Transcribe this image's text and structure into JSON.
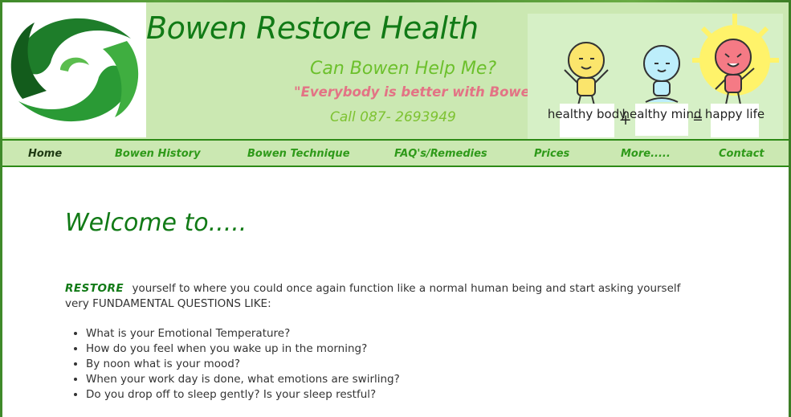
{
  "header": {
    "title": "Bowen Restore Health",
    "help_question": "Can Bowen Help Me?",
    "motto": "\"Everybody is better with Bowen\"",
    "phone": "Call 087- 2693949"
  },
  "illustration": {
    "labels": [
      "healthy body",
      "+",
      "healthy mind",
      "=",
      "happy life"
    ]
  },
  "nav": {
    "items": [
      {
        "label": "Home"
      },
      {
        "label": "Bowen History"
      },
      {
        "label": "Bowen Technique"
      },
      {
        "label": "FAQ's/Remedies"
      },
      {
        "label": "Prices"
      },
      {
        "label": "More....."
      },
      {
        "label": "Contact"
      }
    ]
  },
  "main": {
    "welcome": "Welcome to.....",
    "restore_word": "RESTORE",
    "intro_text": "yourself to where you could once again function like a normal human being and start asking yourself very FUNDAMENTAL QUESTIONS LIKE:",
    "questions": [
      "What is your Emotional Temperature?",
      "How do you feel when you wake up in the morning?",
      "By noon what is your mood?",
      "When your work day is done, what emotions are swirling?",
      "Do you drop off to sleep gently? Is your sleep restful?"
    ]
  },
  "colors": {
    "brand_green": "#117a16",
    "nav_green": "#2f9a1a",
    "motto_pink": "#e37385",
    "header_bg": "#cbe8b2"
  }
}
